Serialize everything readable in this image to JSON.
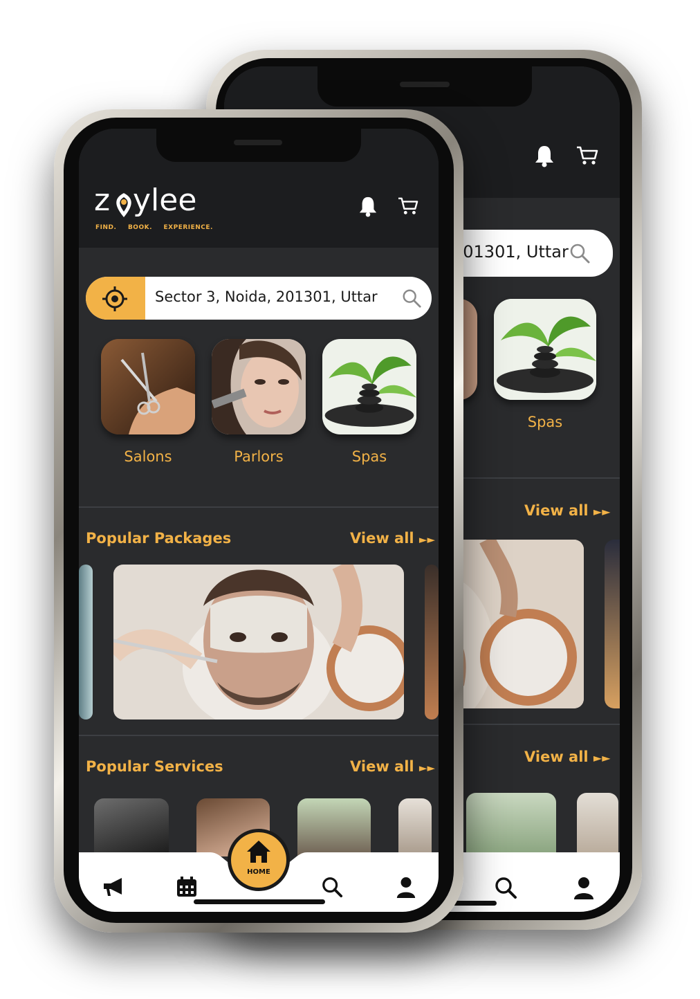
{
  "brand": {
    "name": "zoylee",
    "tagline": [
      "FIND.",
      "BOOK.",
      "EXPERIENCE."
    ]
  },
  "colors": {
    "accent": "#f2b247",
    "background": "#2a2b2d",
    "header": "#1c1d1f"
  },
  "header_icons": [
    "bell-icon",
    "cart-icon"
  ],
  "search": {
    "location_value": "Sector 3, Noida, 201301, Uttar",
    "back_value": "201301, Uttar"
  },
  "categories": [
    {
      "label": "Salons"
    },
    {
      "label": "Parlors"
    },
    {
      "label": "Spas"
    }
  ],
  "popular_packages": {
    "title": "Popular Packages",
    "view_all": "View all"
  },
  "popular_services": {
    "title": "Popular Services",
    "view_all": "View all"
  },
  "nav": {
    "items": [
      "megaphone-icon",
      "calendar-icon",
      "home-icon",
      "search-icon",
      "user-icon"
    ],
    "home_label": "HOME"
  }
}
